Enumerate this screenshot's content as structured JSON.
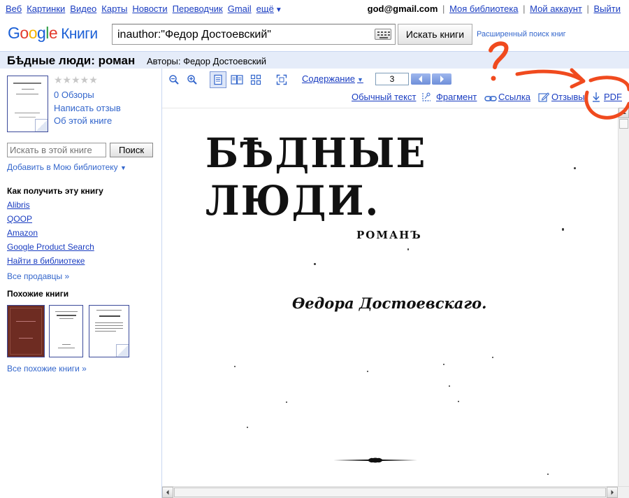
{
  "topnav": {
    "links": [
      "Веб",
      "Картинки",
      "Видео",
      "Карты",
      "Новости",
      "Переводчик",
      "Gmail"
    ],
    "more": "ещё",
    "user": "god@gmail.com",
    "account_links": [
      "Моя библиотека",
      "Мой аккаунт",
      "Выйти"
    ]
  },
  "header": {
    "logo": "Google",
    "logo_suffix": "Книги",
    "search_value": "inauthor:\"Федор Достоевский\"",
    "search_button": "Искать книги",
    "advanced_link": "Расширенный поиск книг"
  },
  "book": {
    "title": "Бѣдные люди: роман",
    "authors_label": "Авторы:",
    "authors": "Федор Достоевский"
  },
  "sidebar": {
    "rating_stars": "★★★★★",
    "reviews": "0 Обзоры",
    "write_review": "Написать отзыв",
    "about": "Об этой книге",
    "search_placeholder": "Искать в этой книге",
    "search_button": "Поиск",
    "add_library": "Добавить в Мою библиотеку",
    "get_book_heading": "Как получить эту книгу",
    "sellers": [
      "Alibris",
      "QOOP",
      "Amazon",
      "Google Product Search",
      "Найти в библиотеке"
    ],
    "all_sellers": "Все продавцы »",
    "similar_heading": "Похожие книги",
    "all_similar": "Все похожие книги »"
  },
  "viewer": {
    "contents": "Содержание",
    "page_number": "3",
    "links": {
      "plain_text": "Обычный текст",
      "clip": "Фрагмент",
      "link": "Ссылка",
      "reviews": "Отзывы",
      "pdf": "PDF"
    }
  },
  "scan": {
    "title": "БѢДНЫЕ ЛЮДИ.",
    "subtitle": "РОМАНЪ",
    "author": "Ѳедора Достоевскаго."
  },
  "colors": {
    "link_blue": "#1a3dc1",
    "accent_blue": "#3366cc",
    "title_bar": "#e5ecf9",
    "annotation_red": "#f04a1e"
  }
}
